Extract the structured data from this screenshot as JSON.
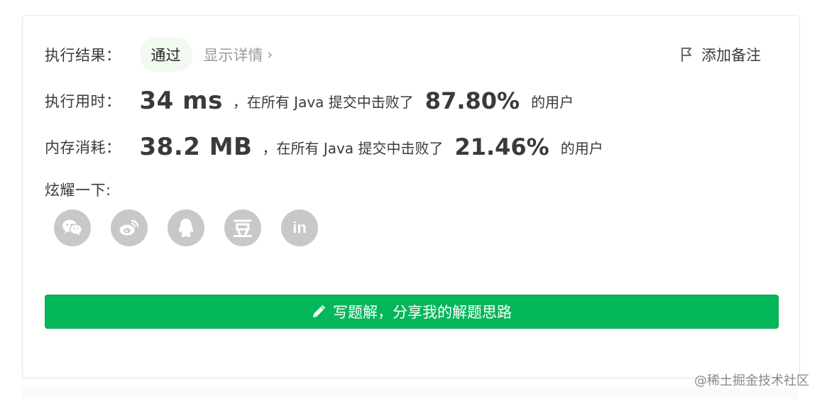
{
  "result": {
    "label": "执行结果：",
    "status": "通过",
    "details_link": "显示详情",
    "add_note": "添加备注"
  },
  "runtime": {
    "label": "执行用时：",
    "value": "34 ms",
    "mid_text": "，在所有 Java 提交中击败了",
    "percent": "87.80%",
    "tail": "的用户"
  },
  "memory": {
    "label": "内存消耗：",
    "value": "38.2 MB",
    "mid_text": "，在所有 Java 提交中击败了",
    "percent": "21.46%",
    "tail": "的用户"
  },
  "share": {
    "label": "炫耀一下:",
    "icons": [
      "wechat-icon",
      "weibo-icon",
      "qq-icon",
      "douban-icon",
      "linkedin-icon"
    ],
    "douban_glyph": "豆",
    "linkedin_glyph": "in"
  },
  "write_solution": {
    "label": "写题解，分享我的解题思路"
  },
  "watermark": "@稀土掘金技术社区",
  "colors": {
    "accent_green": "#05b75b",
    "badge_bg": "#f2f9f1",
    "icon_gray": "#c8c8c8"
  }
}
